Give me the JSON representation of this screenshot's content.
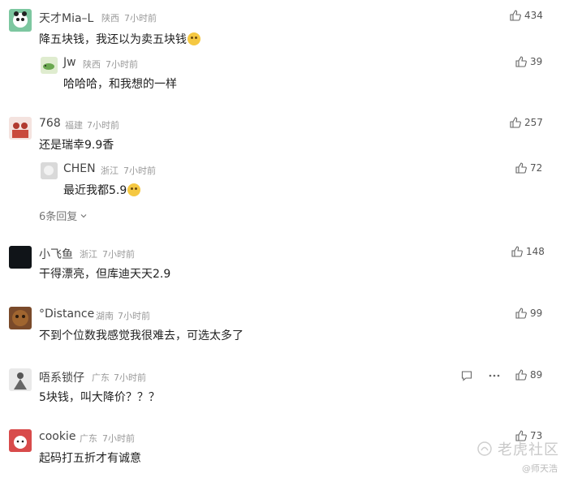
{
  "comments": [
    {
      "user": "天才Mia–L",
      "region": "陕西",
      "time": "7小时前",
      "text": "降五块钱，我还以为卖五块钱",
      "likes": "434",
      "emoji": true
    },
    {
      "user": "Jw",
      "region": "陕西",
      "time": "7小时前",
      "text": "哈哈哈，和我想的一样",
      "likes": "39"
    },
    {
      "user": "768",
      "region": "福建",
      "time": "7小时前",
      "text": "还是瑞幸9.9香",
      "likes": "257"
    },
    {
      "user": "CHEN",
      "region": "浙江",
      "time": "7小时前",
      "text": "最近我都5.9",
      "likes": "72",
      "emoji": true
    },
    {
      "more_replies": "6条回复"
    },
    {
      "user": "小飞鱼",
      "region": "浙江",
      "time": "7小时前",
      "text": "干得漂亮，但库迪天天2.9",
      "likes": "148"
    },
    {
      "user": "°Distance",
      "region": "湖南",
      "time": "7小时前",
      "text": "不到个位数我感觉我很难去，可选太多了",
      "likes": "99"
    },
    {
      "user": "唔系锁仔",
      "region": "广东",
      "time": "7小时前",
      "text": "5块钱，叫大降价？？？",
      "likes": "89"
    },
    {
      "user": "cookie",
      "region": "广东",
      "time": "7小时前",
      "text": "起码打五折才有诚意",
      "likes": "73"
    }
  ],
  "watermark": {
    "brand": "老虎社区",
    "author": "@师天浩"
  },
  "colors": {
    "like": "#555555",
    "meta": "#999999"
  }
}
